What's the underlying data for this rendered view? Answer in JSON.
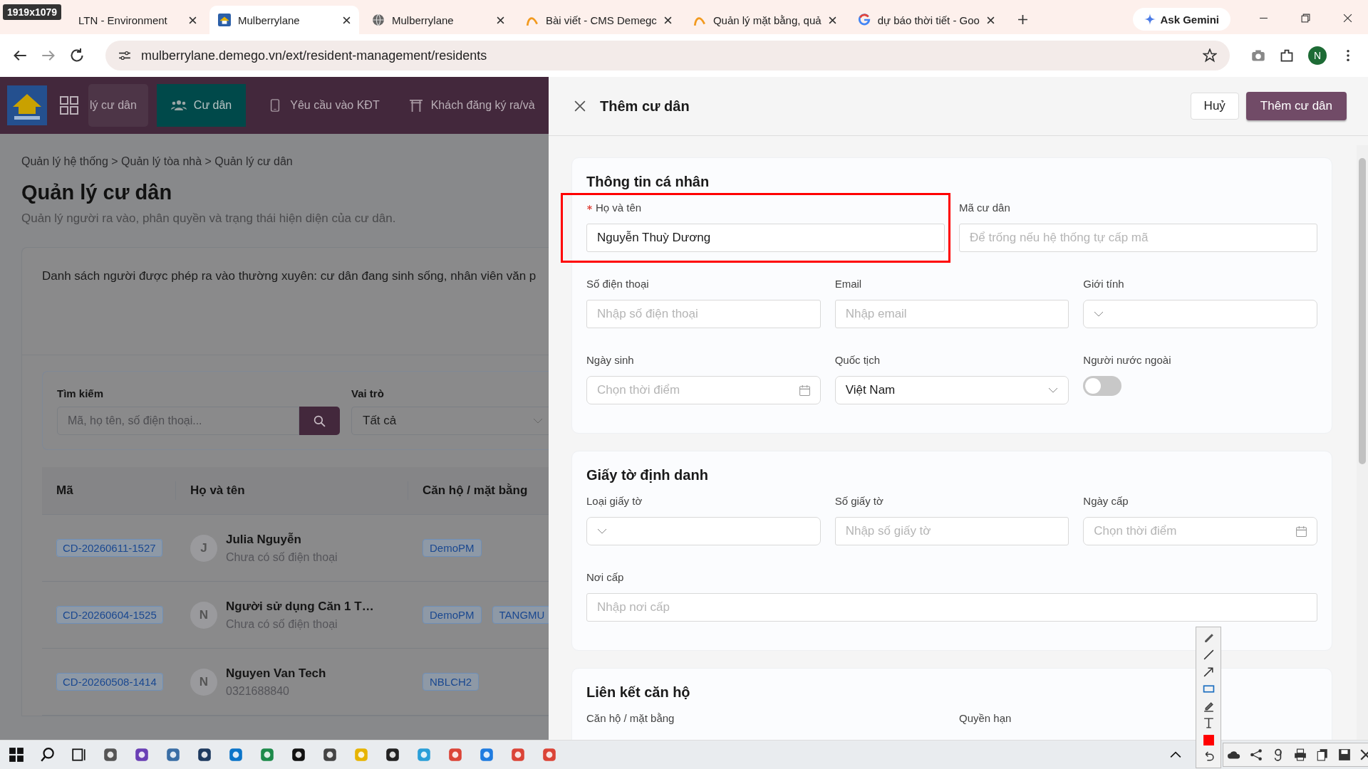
{
  "capture_tool": {
    "size_label": "1919x1079"
  },
  "browser": {
    "tabs": [
      {
        "title": "LTN - Environment",
        "selected": false,
        "kind": "hidden"
      },
      {
        "title": "Mulberrylane",
        "selected": true,
        "kind": "app"
      },
      {
        "title": "Mulberrylane",
        "selected": false,
        "kind": "globe"
      },
      {
        "title": "Bài viết - CMS Demegc",
        "selected": false,
        "kind": "arc"
      },
      {
        "title": "Quản lý mặt bằng, quả",
        "selected": false,
        "kind": "arc"
      },
      {
        "title": "dự báo thời tiết - Goo",
        "selected": false,
        "kind": "google"
      }
    ],
    "gemini": "Ask Gemini",
    "url": "mulberrylane.demego.vn/ext/resident-management/residents",
    "profile": "N"
  },
  "app": {
    "nav": [
      {
        "label": "lý cư dân",
        "selected": false,
        "kind": "plain"
      },
      {
        "label": "Cư dân",
        "selected": true,
        "kind": "people"
      },
      {
        "label": "Yêu cầu vào KĐT",
        "selected": false,
        "kind": "phone"
      },
      {
        "label": "Khách đăng ký ra/và",
        "selected": false,
        "kind": "gate"
      }
    ],
    "breadcrumb": "Quản lý hệ thống > Quản lý tòa nhà > Quản lý cư dân",
    "title": "Quản lý cư dân",
    "subtitle": "Quản lý người ra vào, phân quyền và trạng thái hiện diện của cư dân.",
    "description": "Danh sách người được phép ra vào thường xuyên: cư dân đang sinh sống, nhân viên văn p",
    "search": {
      "label": "Tìm kiếm",
      "placeholder": "Mã, họ tên, số điện thoại..."
    },
    "role": {
      "label": "Vai trò",
      "value": "Tất cả"
    },
    "table": {
      "columns": [
        "Mã",
        "Họ và tên",
        "Căn hộ / mặt bằng"
      ],
      "rows": [
        {
          "code": "CD-20260611-1527",
          "initial": "J",
          "name": "Julia Nguyễn",
          "phone": "Chưa có số điện thoại",
          "units": [
            "DemoPM"
          ]
        },
        {
          "code": "CD-20260604-1525",
          "initial": "N",
          "name": "Người sử dụng Căn 1 T…",
          "phone": "Chưa có số điện thoại",
          "units": [
            "DemoPM",
            "TANGMU"
          ]
        },
        {
          "code": "CD-20260508-1414",
          "initial": "N",
          "name": "Nguyen Van Tech",
          "phone": "0321688840",
          "units": [
            "NBLCH2"
          ]
        }
      ]
    }
  },
  "drawer": {
    "title": "Thêm cư dân",
    "cancel": "Huỷ",
    "submit": "Thêm cư dân",
    "sections": [
      {
        "title": "Thông tin cá nhân",
        "lines": [
          [
            {
              "label": "Họ và tên",
              "required": true,
              "annotated": true,
              "kind": "text",
              "value": "Nguyễn Thuỳ Dương"
            },
            {
              "label": "Mã cư dân",
              "kind": "text",
              "placeholder": "Để trống nếu hệ thống tự cấp mã"
            }
          ],
          [
            {
              "label": "Số điện thoại",
              "kind": "text",
              "placeholder": "Nhập số điện thoại"
            },
            {
              "label": "Email",
              "kind": "text",
              "placeholder": "Nhập email"
            },
            {
              "label": "Giới tính",
              "kind": "select"
            }
          ],
          [
            {
              "label": "Ngày sinh",
              "kind": "date",
              "placeholder": "Chọn thời điểm"
            },
            {
              "label": "Quốc tịch",
              "kind": "select",
              "value": "Việt Nam"
            },
            {
              "label": "Người nước ngoài",
              "kind": "toggle",
              "on": false
            }
          ]
        ]
      },
      {
        "title": "Giấy tờ định danh",
        "lines": [
          [
            {
              "label": "Loại giấy tờ",
              "kind": "select"
            },
            {
              "label": "Số giấy tờ",
              "kind": "text",
              "placeholder": "Nhập số giấy tờ"
            },
            {
              "label": "Ngày cấp",
              "kind": "date",
              "placeholder": "Chọn thời điểm"
            }
          ],
          [
            {
              "label": "Nơi cấp",
              "kind": "text",
              "placeholder": "Nhập nơi cấp"
            }
          ]
        ]
      },
      {
        "title": "Liên kết căn hộ",
        "lines": [
          [
            {
              "label": "Căn hộ / mặt bằng",
              "kind": "label"
            },
            {
              "label": "Quyền hạn",
              "kind": "label"
            }
          ]
        ]
      }
    ]
  }
}
